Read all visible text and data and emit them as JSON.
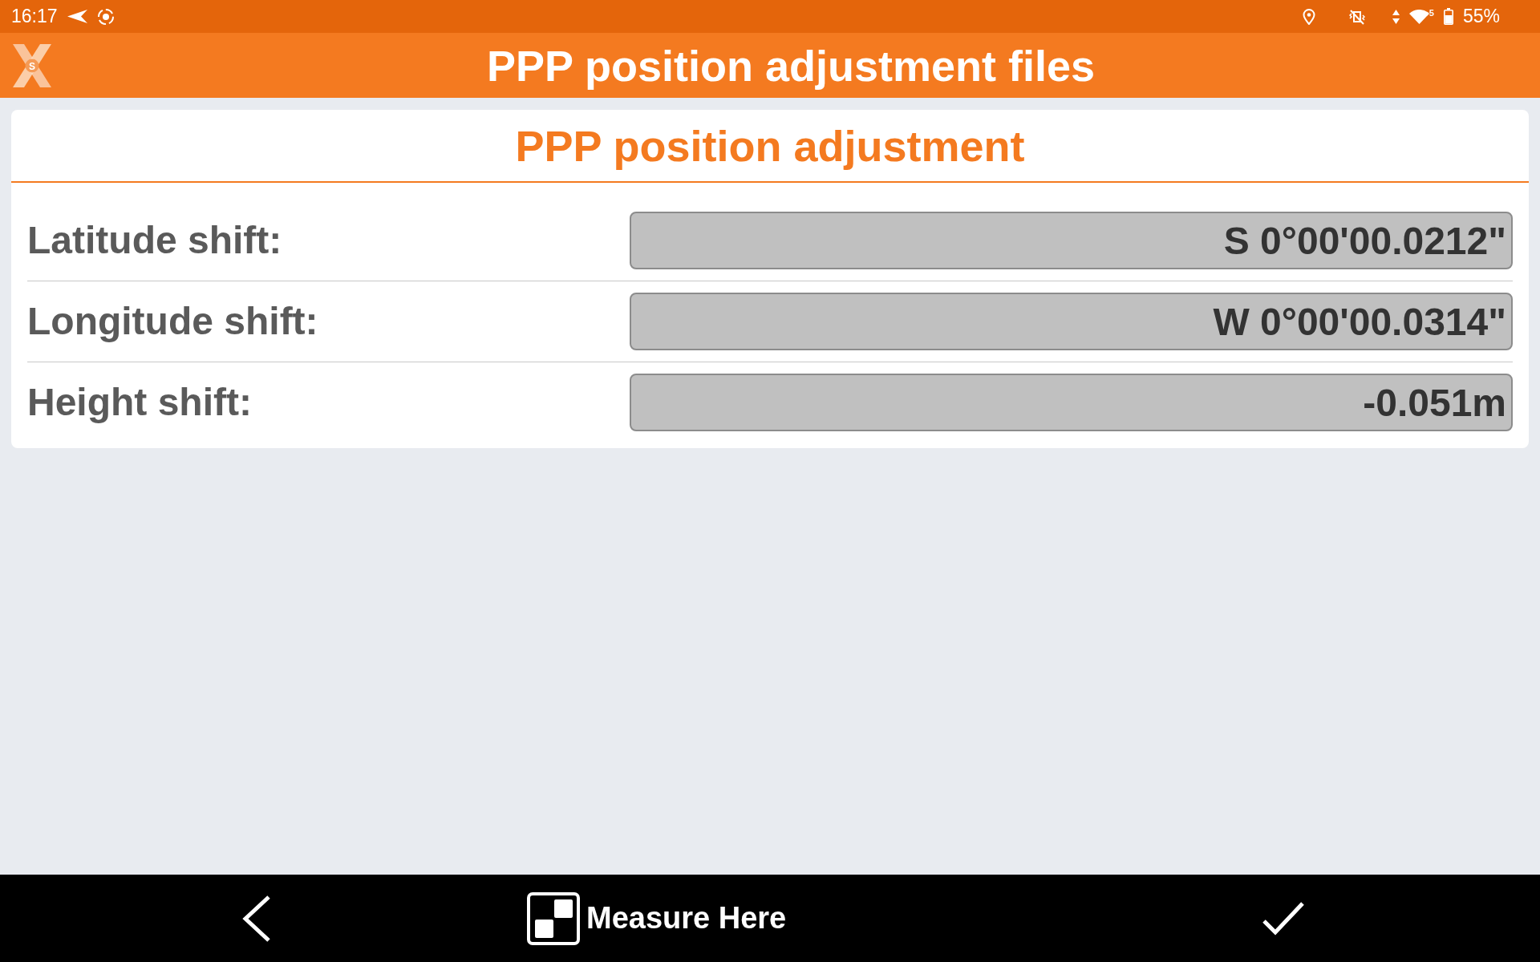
{
  "status_bar": {
    "time": "16:17",
    "wifi_band": "5",
    "battery": "55%"
  },
  "app_bar": {
    "logo_letter": "S",
    "title": "PPP position adjustment files"
  },
  "panel": {
    "title": "PPP position adjustment",
    "rows": [
      {
        "label": "Latitude shift:",
        "value": "S 0°00'00.0212\"",
        "readonly": true
      },
      {
        "label": "Longitude shift:",
        "value": "W 0°00'00.0314\"",
        "readonly": true
      },
      {
        "label": "Height shift:",
        "value": "-0.051m",
        "readonly": true
      }
    ]
  },
  "bottom_bar": {
    "buttons": [
      {
        "kind": "back"
      },
      {
        "kind": "measure",
        "label": "Measure Here"
      },
      {
        "kind": "confirm"
      }
    ]
  }
}
